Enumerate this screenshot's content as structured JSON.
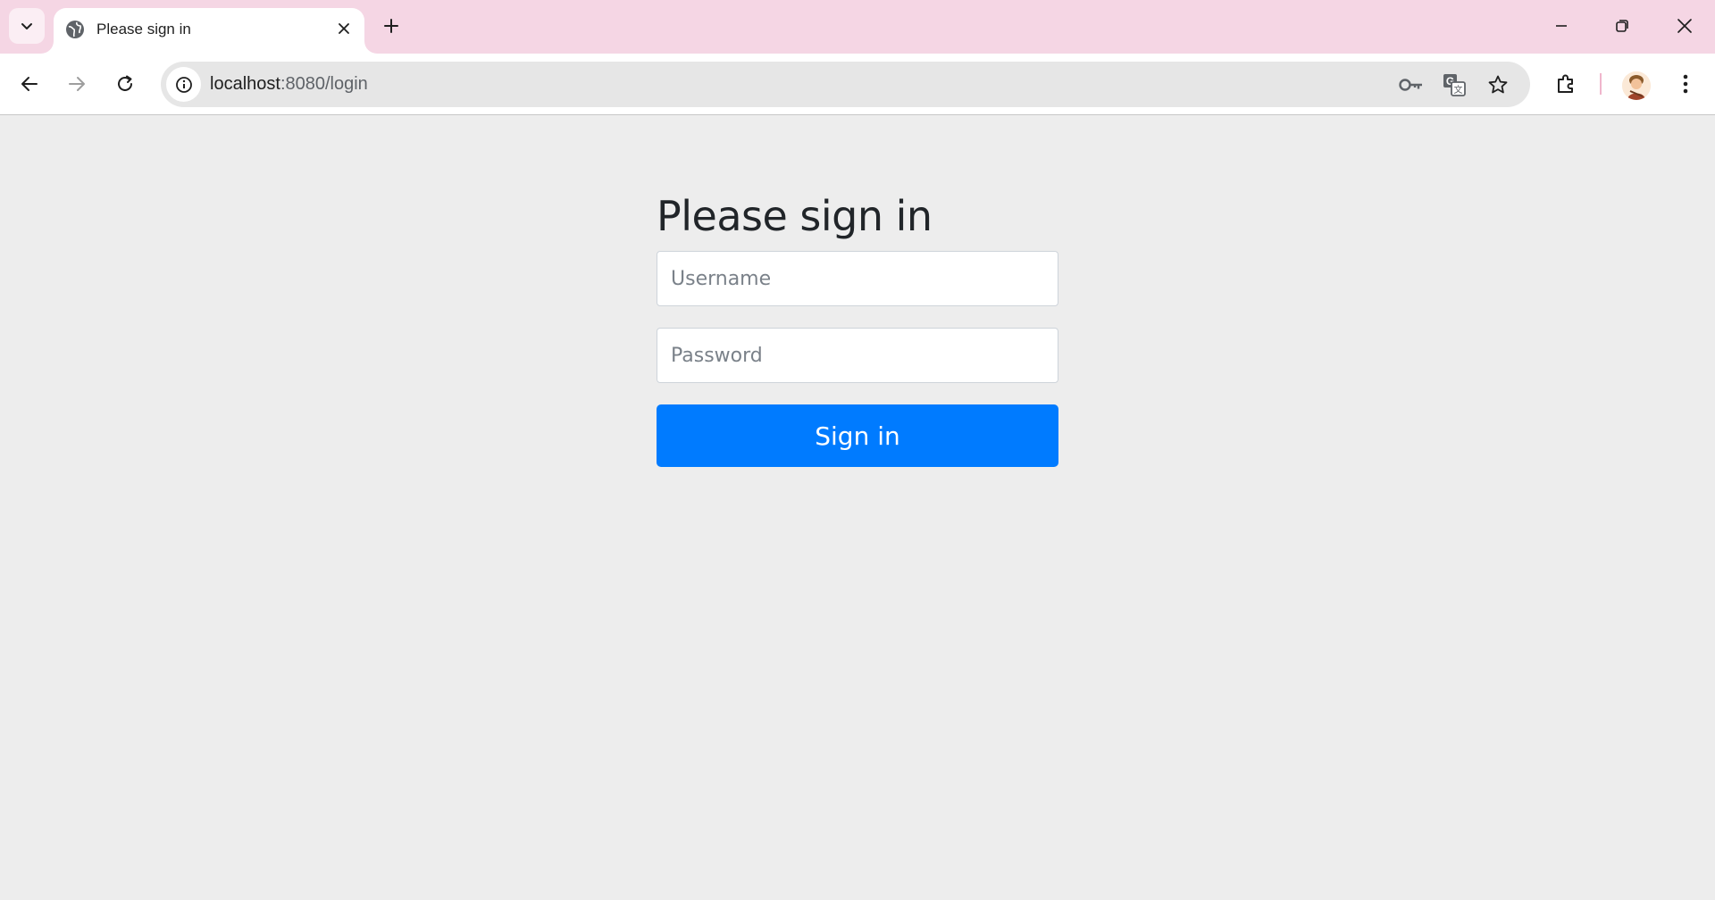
{
  "browser": {
    "tab": {
      "title": "Please sign in"
    },
    "url": {
      "host": "localhost",
      "path": ":8080/login"
    }
  },
  "page": {
    "heading": "Please sign in",
    "username_placeholder": "Username",
    "password_placeholder": "Password",
    "submit_label": "Sign in"
  },
  "colors": {
    "tabstrip": "#f5d6e4",
    "primary_button": "#007bff",
    "page_background": "#ededed"
  }
}
